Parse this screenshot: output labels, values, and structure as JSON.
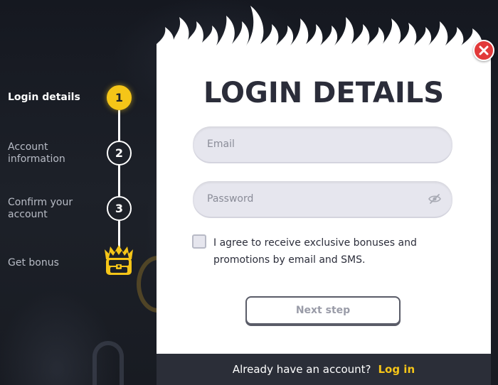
{
  "stepper": {
    "steps": [
      {
        "number": "1",
        "label": "Login details",
        "active": true
      },
      {
        "number": "2",
        "label_line1": "Account",
        "label_line2": "information"
      },
      {
        "number": "3",
        "label_line1": "Confirm your",
        "label_line2": "account"
      },
      {
        "label": "Get bonus",
        "icon": "treasure-chest-fire-icon"
      }
    ],
    "active_color": "#f5c518"
  },
  "modal": {
    "title": "LOGIN DETAILS",
    "email_placeholder": "Email",
    "password_placeholder": "Password",
    "agree_text": "I agree to receive exclusive bonuses and promotions by email and SMS.",
    "next_label": "Next step",
    "footer_question": "Already have an account?",
    "footer_link": "Log in",
    "close_icon": "close-icon",
    "close_color": "#e23a3a"
  }
}
